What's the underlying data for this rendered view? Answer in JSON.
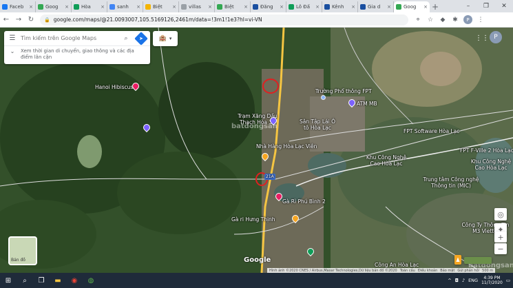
{
  "browser": {
    "tabs": [
      {
        "title": "Faceb",
        "favicon_color": "#1877f2",
        "active": false
      },
      {
        "title": "Goog",
        "favicon_color": "#34a853",
        "active": false
      },
      {
        "title": "Hòa",
        "favicon_color": "#0f9d58",
        "active": false
      },
      {
        "title": "sanh",
        "favicon_color": "#4285f4",
        "active": false
      },
      {
        "title": "Biệt",
        "favicon_color": "#f4b400",
        "active": false
      },
      {
        "title": "villas",
        "favicon_color": "#9aa0a6",
        "active": false
      },
      {
        "title": "Biệt",
        "favicon_color": "#34a853",
        "active": false
      },
      {
        "title": "Đăng",
        "favicon_color": "#1a4fa0",
        "active": false
      },
      {
        "title": "Lô Đấ",
        "favicon_color": "#0f9d58",
        "active": false
      },
      {
        "title": "Kênh",
        "favicon_color": "#1a4fa0",
        "active": false
      },
      {
        "title": "Gia d",
        "favicon_color": "#1a4fa0",
        "active": false
      },
      {
        "title": "Goog",
        "favicon_color": "#34a853",
        "active": true
      }
    ],
    "new_tab": "+",
    "url": "google.com/maps/@21.0093007,105.5169126,2461m/data=!3m1!1e3?hl=vi-VN"
  },
  "search": {
    "placeholder": "Tìm kiếm trên Google Maps",
    "subtitle": "Xem thời gian di chuyển, giao thông và các địa điểm lân cận"
  },
  "map_labels": {
    "hanoi_hibiscus": "Hanoi Hibiscus",
    "truong_pho_thong": "Trường Phổ thông FPT",
    "atm": "ATM MB",
    "tram_xang": "Trạm Xăng Dầu Thạch Hòa 39",
    "san_tap_lai": "Sân Tập Lái Ô tô Hòa Lạc",
    "nha_hang": "Nhà Hàng Hòa Lạc Viên",
    "fpt_software": "FPT Software Hòa Lạc",
    "fpt_fville": "FPT F-Ville 2 Hòa Lạc",
    "khu_cong_nghe": "Khu Công Nghệ Cao Hòa Lạc",
    "khu_cong_nghe_2": "Khu Công Nghệ Cao Hòa Lạc",
    "trung_tam": "Trung tâm Công nghệ Thông tin (MIC)",
    "ga_ri_phu_binh": "Gà Rì Phú Bình 2",
    "ga_ri_hung_thinh": "Gà ri Hưng Thịnh",
    "cong_ty": "Công Ty Thông Tin M3 Viettel",
    "cong_an": "Công An Hòa Lạc",
    "road_shield": "21A",
    "watermark": "batdongsan"
  },
  "map_ui": {
    "layer_label": "Bản đồ",
    "logo": "Google",
    "attribution": "Hình ảnh ©2020 CNES / Airbus,Maxar Technologies,Dữ liệu bản đồ ©2020",
    "attr_links": [
      "Toàn cầu",
      "Điều khoản",
      "Bảo mật",
      "Gửi phản hồi",
      "500 m"
    ]
  },
  "taskbar": {
    "lang": "ENG",
    "time": "4:39 PM",
    "date": "11/7/2020"
  }
}
